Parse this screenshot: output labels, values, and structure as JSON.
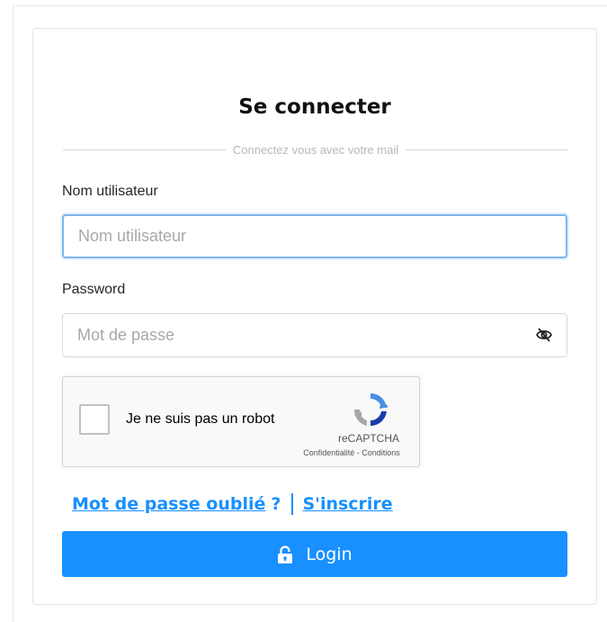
{
  "login": {
    "title": "Se connecter",
    "divider_text": "Connectez vous avec votre mail",
    "username": {
      "label": "Nom utilisateur",
      "placeholder": "Nom utilisateur",
      "value": ""
    },
    "password": {
      "label": "Password",
      "placeholder": "Mot de passe",
      "value": "",
      "toggle_icon": "eye-invisible-icon"
    },
    "recaptcha": {
      "checkbox_label": "Je ne suis pas un robot",
      "brand": "reCAPTCHA",
      "links": "Confidentialité - Conditions",
      "checked": false
    },
    "forgot_password_link": "Mot de passe oublié",
    "question_mark": "?",
    "register_link": "S'inscrire",
    "login_button": "Login",
    "login_icon": "unlock-icon"
  },
  "colors": {
    "primary": "#1890ff",
    "focus_border": "#7fb3ee",
    "title": "#111111"
  }
}
